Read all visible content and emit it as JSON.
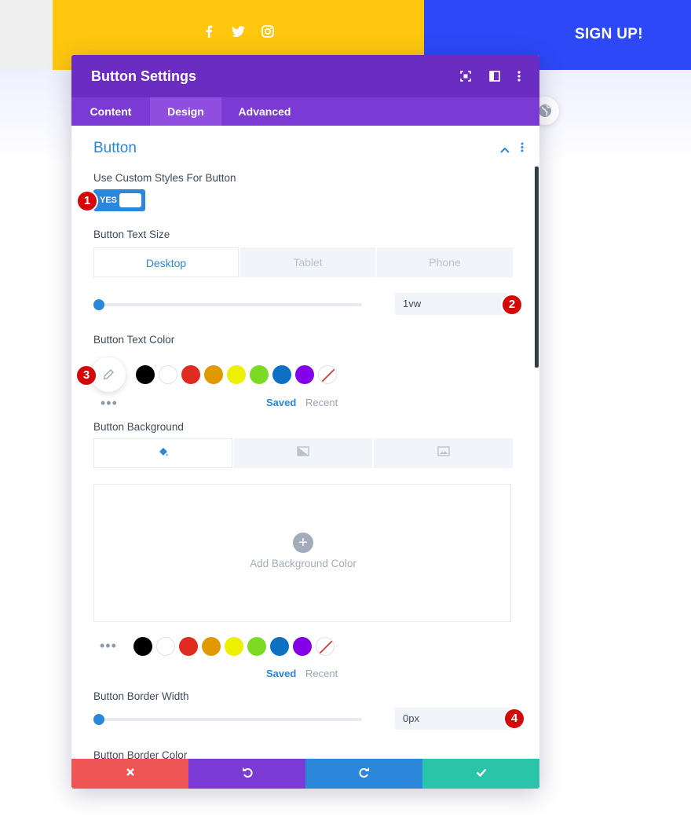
{
  "page": {
    "signup_label": "SIGN UP!"
  },
  "modal": {
    "title": "Button Settings",
    "tabs": [
      {
        "label": "Content",
        "active": false
      },
      {
        "label": "Design",
        "active": true
      },
      {
        "label": "Advanced",
        "active": false
      }
    ],
    "section_title": "Button",
    "custom_styles": {
      "label": "Use Custom Styles For Button",
      "toggle_text": "YES",
      "enabled": true
    },
    "text_size": {
      "label": "Button Text Size",
      "device_tabs": [
        "Desktop",
        "Tablet",
        "Phone"
      ],
      "active_device": "Desktop",
      "value": "1vw",
      "slider_fraction": 0
    },
    "text_color": {
      "label": "Button Text Color",
      "saved_label": "Saved",
      "recent_label": "Recent"
    },
    "background": {
      "label": "Button Background",
      "add_label": "Add Background Color",
      "add_symbol": "+",
      "saved_label": "Saved",
      "recent_label": "Recent"
    },
    "border_width": {
      "label": "Button Border Width",
      "value": "0px",
      "slider_fraction": 0
    },
    "border_color": {
      "label": "Button Border Color"
    },
    "more_dots": "•••"
  },
  "palette": [
    "#000000",
    "#ffffff",
    "#e02b20",
    "#e09900",
    "#edf000",
    "#7cda24",
    "#0c71c3",
    "#8300e9",
    "none"
  ],
  "markers": [
    "1",
    "2",
    "3",
    "4"
  ],
  "colors": {
    "header": "#6b2cc2",
    "tabs": "#7b3ad4",
    "accent": "#2b87da",
    "cancel": "#ef5555",
    "undo": "#7b3ad4",
    "redo": "#2b87da",
    "save": "#29c4a9",
    "marker": "#d40808"
  },
  "icons": [
    "facebook-icon",
    "twitter-icon",
    "instagram-icon",
    "globe-icon",
    "fullscreen-icon",
    "columns-icon",
    "more-vertical-icon",
    "chevron-up-icon",
    "eyedropper-icon",
    "paint-bucket-icon",
    "gradient-icon",
    "image-icon",
    "close-icon",
    "undo-icon",
    "redo-icon",
    "check-icon"
  ]
}
